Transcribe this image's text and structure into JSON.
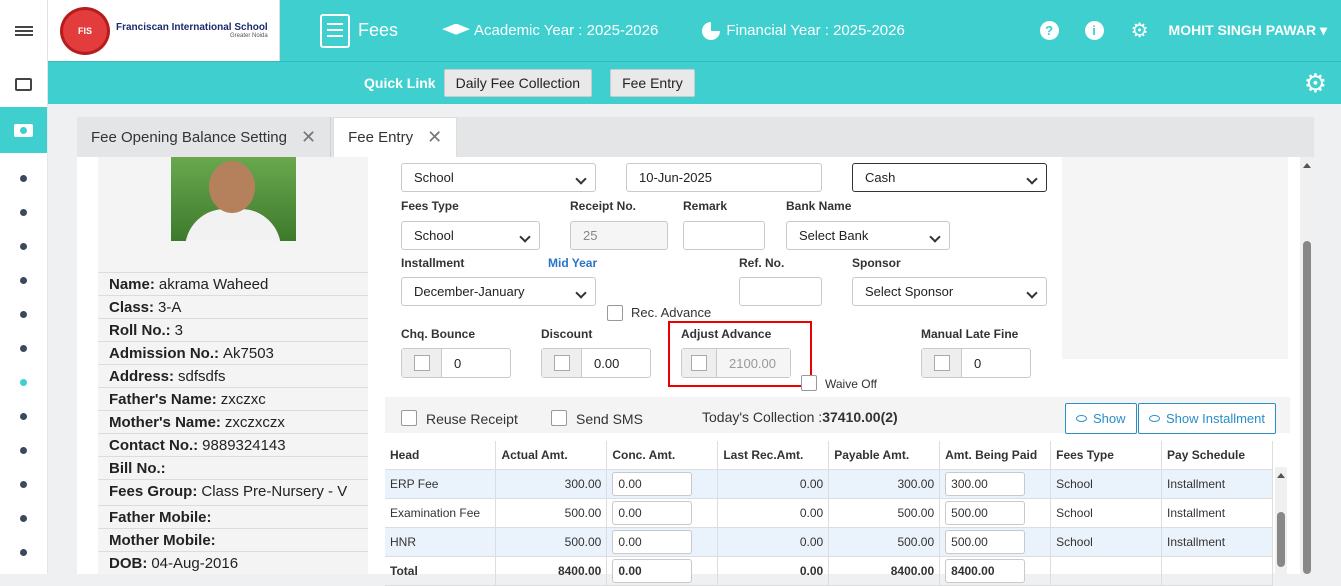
{
  "header": {
    "school_name": "Franciscan International School",
    "school_location": "Greater Noida",
    "module": "Fees",
    "academic_year": "Academic Year : 2025-2026",
    "financial_year": "Financial Year : 2025-2026",
    "user": "MOHIT SINGH PAWAR"
  },
  "quicklink": {
    "label": "Quick Link",
    "btn1": "Daily Fee Collection",
    "btn2": "Fee Entry"
  },
  "tabs": [
    {
      "label": "Fee Opening Balance Setting"
    },
    {
      "label": "Fee Entry"
    }
  ],
  "student": {
    "name_label": "Name:",
    "name": "akrama Waheed",
    "class_label": "Class:",
    "class": "3-A",
    "roll_label": "Roll No.:",
    "roll": "3",
    "adm_label": "Admission No.:",
    "adm": "Ak7503",
    "addr_label": "Address:",
    "addr": "sdfsdfs",
    "father_label": "Father's Name:",
    "father": "zxczxc",
    "mother_label": "Mother's Name:",
    "mother": "zxczxczx",
    "contact_label": "Contact No.:",
    "contact": "9889324143",
    "bill_label": "Bill No.:",
    "bill": "",
    "group_label": "Fees Group:",
    "group": "Class Pre-Nursery - V",
    "fmobile_label": "Father Mobile:",
    "fmobile": "",
    "mmobile_label": "Mother Mobile:",
    "mmobile": "",
    "dob_label": "DOB:",
    "dob": "04-Aug-2016"
  },
  "form": {
    "top_select1": "School",
    "date": "10-Jun-2025",
    "payment_mode": "Cash",
    "fees_type_label": "Fees Type",
    "fees_type": "School",
    "receipt_label": "Receipt No.",
    "receipt_placeholder": "25",
    "remark_label": "Remark",
    "remark": "",
    "bank_label": "Bank Name",
    "bank": "Select Bank",
    "inst_label": "Installment",
    "midyear_label": "Mid Year",
    "installment": "December-January",
    "ref_label": "Ref. No.",
    "ref": "",
    "sponsor_label": "Sponsor",
    "sponsor": "Select Sponsor",
    "rec_advance_label": "Rec. Advance",
    "chq_label": "Chq. Bounce",
    "chq": "0",
    "discount_label": "Discount",
    "discount": "0.00",
    "adjust_label": "Adjust Advance",
    "adjust": "2100.00",
    "late_label": "Manual Late Fine",
    "late": "0",
    "waive_label": "Waive Off",
    "reuse_label": "Reuse Receipt",
    "sms_label": "Send SMS",
    "collection_label": "Today's Collection :",
    "collection_value": "37410.00(2)",
    "show_btn": "Show",
    "show_inst_btn": "Show Installment"
  },
  "table": {
    "headers": [
      "Head",
      "Actual Amt.",
      "Conc. Amt.",
      "Last Rec.Amt.",
      "Payable Amt.",
      "Amt. Being Paid",
      "Fees Type",
      "Pay Schedule"
    ],
    "rows": [
      {
        "head": "ERP Fee",
        "actual": "300.00",
        "conc": "0.00",
        "last": "0.00",
        "payable": "300.00",
        "paid": "300.00",
        "type": "School",
        "schedule": "Installment"
      },
      {
        "head": "Examination Fee",
        "actual": "500.00",
        "conc": "0.00",
        "last": "0.00",
        "payable": "500.00",
        "paid": "500.00",
        "type": "School",
        "schedule": "Installment"
      },
      {
        "head": "HNR",
        "actual": "500.00",
        "conc": "0.00",
        "last": "0.00",
        "payable": "500.00",
        "paid": "500.00",
        "type": "School",
        "schedule": "Installment"
      }
    ],
    "total": {
      "head": "Total",
      "actual": "8400.00",
      "conc": "0.00",
      "last": "0.00",
      "payable": "8400.00",
      "paid": "8400.00"
    }
  }
}
